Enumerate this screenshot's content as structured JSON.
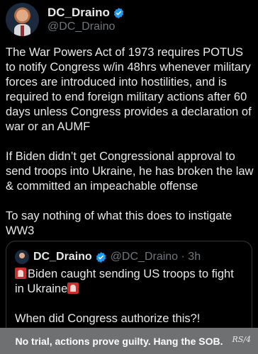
{
  "post": {
    "display_name": "DC_Draino",
    "handle": "@DC_Draino",
    "paragraphs": [
      "The War Powers Act of 1973 requires POTUS to notify Congress w/in 48hrs whenever military forces are introduced into hostilities, and is required to end foreign military actions after 60 days unless Congress provides a declaration of war or an AUMF",
      "If Biden didn’t get Congressional approval to send troops into Ukraine, he has broken the law & committed an impeachable offense",
      "To say nothing of what this does to instigate WW3"
    ]
  },
  "quoted_post": {
    "display_name": "DC_Draino",
    "handle_time": "@DC_Draino · 3h",
    "line1": "Biden caught sending US troops to fight in Ukraine",
    "line2": "When did Congress authorize this?!"
  },
  "caption": {
    "text": "No trial, actions prove guilty. Hang the SOB.",
    "signature": "RS/4"
  },
  "colors": {
    "background": "#000000",
    "verified": "#1d9bf0",
    "caption_bar": "#6e7072"
  },
  "icons": [
    "verified-badge-icon",
    "siren-emoji-icon"
  ]
}
